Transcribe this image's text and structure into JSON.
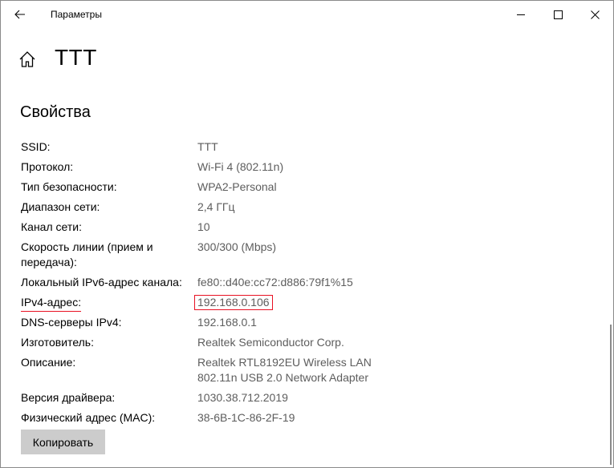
{
  "window": {
    "title": "Параметры"
  },
  "header": {
    "title": "TTT",
    "home_icon": "home-icon"
  },
  "section": {
    "title": "Свойства"
  },
  "properties": [
    {
      "label": "SSID:",
      "value": "TTT"
    },
    {
      "label": "Протокол:",
      "value": "Wi-Fi 4 (802.11n)"
    },
    {
      "label": "Тип безопасности:",
      "value": "WPA2-Personal"
    },
    {
      "label": "Диапазон сети:",
      "value": "2,4 ГГц"
    },
    {
      "label": "Канал сети:",
      "value": "10"
    },
    {
      "label": "Скорость линии (прием и передача):",
      "value": "300/300 (Mbps)"
    },
    {
      "label": "Локальный IPv6-адрес канала:",
      "value": "fe80::d40e:cc72:d886:79f1%15"
    },
    {
      "label": "IPv4-адрес:",
      "value": "192.168.0.106"
    },
    {
      "label": "DNS-серверы IPv4:",
      "value": "192.168.0.1"
    },
    {
      "label": "Изготовитель:",
      "value": "Realtek Semiconductor Corp."
    },
    {
      "label": "Описание:",
      "value": "Realtek RTL8192EU Wireless LAN 802.11n USB 2.0 Network Adapter"
    },
    {
      "label": "Версия драйвера:",
      "value": "1030.38.712.2019"
    },
    {
      "label": "Физический адрес (MAC):",
      "value": "38-6B-1C-86-2F-19"
    }
  ],
  "actions": {
    "copy_label": "Копировать"
  },
  "colors": {
    "highlight": "#e81123",
    "value_text": "#5d5d5d",
    "button_bg": "#cccccc"
  }
}
